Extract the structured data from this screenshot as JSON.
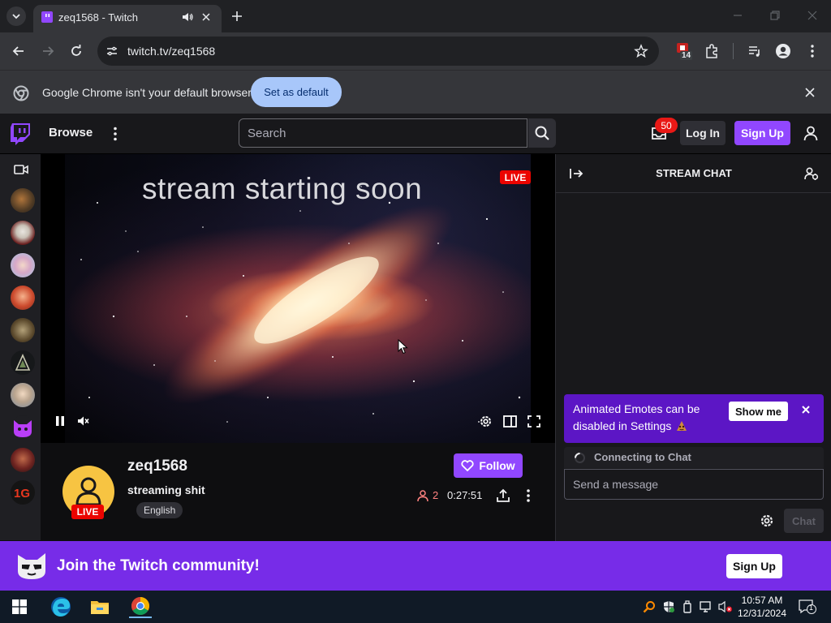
{
  "browser": {
    "tab_title": "zeq1568 - Twitch",
    "url": "twitch.tv/zeq1568",
    "extension_badge": "14",
    "infobar_message": "Google Chrome isn't your default browser",
    "infobar_button": "Set as default"
  },
  "twitch_nav": {
    "browse_label": "Browse",
    "search_placeholder": "Search",
    "inbox_badge": "50",
    "login_label": "Log In",
    "signup_label": "Sign Up"
  },
  "sidebar": {
    "channels": [
      "channel-1",
      "channel-2",
      "channel-3",
      "channel-4",
      "channel-5",
      "channel-6",
      "channel-7",
      "channel-8",
      "channel-9",
      "channel-10"
    ]
  },
  "player": {
    "overlay_text": "stream starting soon",
    "live_label": "LIVE"
  },
  "channel": {
    "name": "zeq1568",
    "stream_title": "streaming shit",
    "language_tag": "English",
    "live_label": "LIVE",
    "follow_label": "Follow",
    "viewer_count": "2",
    "uptime": "0:27:51"
  },
  "chat": {
    "header": "STREAM CHAT",
    "notice_text": "Animated Emotes can be disabled in Settings",
    "notice_button": "Show me",
    "connecting_text": "Connecting to Chat",
    "input_placeholder": "Send a message",
    "chat_button": "Chat"
  },
  "banner": {
    "text": "Join the Twitch community!",
    "button": "Sign Up"
  },
  "taskbar": {
    "time": "10:57 AM",
    "date": "12/31/2024",
    "notification_count": "1"
  },
  "colors": {
    "twitch_purple": "#9147ff",
    "banner_purple": "#772ce8",
    "live_red": "#eb0400",
    "background": "#0e0e10"
  }
}
